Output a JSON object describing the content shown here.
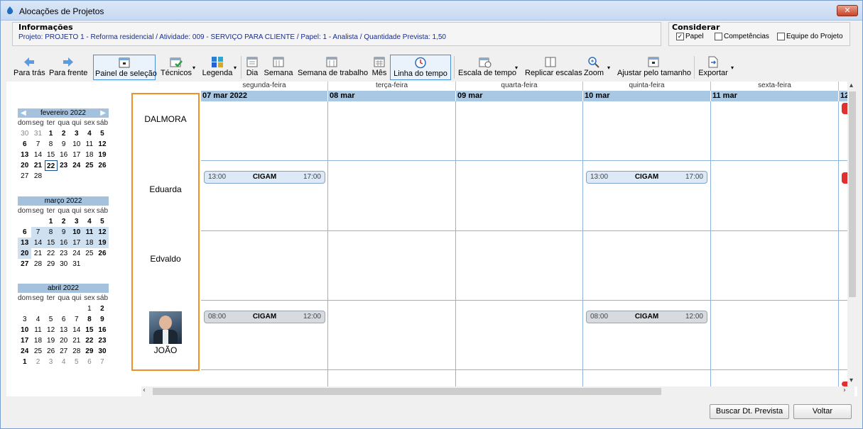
{
  "window": {
    "title": "Alocações de Projetos",
    "close_label": "✕"
  },
  "info": {
    "title": "Informações",
    "details": "Projeto: PROJETO 1 - Reforma residencial  /  Atividade: 009 - SERVIÇO PARA CLIENTE  /  Papel: 1 - Analista  /  Quantidade Prevista: 1,50"
  },
  "consider": {
    "title": "Considerar",
    "options": [
      {
        "label": "Papel",
        "checked": "✓"
      },
      {
        "label": "Competências",
        "checked": ""
      },
      {
        "label": "Equipe do Projeto",
        "checked": ""
      }
    ]
  },
  "toolbar": {
    "back": "Para trás",
    "forward": "Para frente",
    "selection_panel": "Painel de seleção",
    "technicians": "Técnicos",
    "legend": "Legenda",
    "day": "Dia",
    "week": "Semana",
    "work_week": "Semana de trabalho",
    "month": "Mês",
    "timeline": "Linha do tempo",
    "time_scale": "Escala de tempo",
    "replicate_scales": "Replicar escalas",
    "zoom": "Zoom",
    "fit_size": "Ajustar pelo tamanho",
    "export": "Exportar"
  },
  "mini_calendars": [
    {
      "title": "fevereiro 2022",
      "dow": [
        "dom",
        "seg",
        "ter",
        "qua",
        "qui",
        "sex",
        "sáb"
      ],
      "days": [
        "30",
        "31",
        "1",
        "2",
        "3",
        "4",
        "5",
        "6",
        "7",
        "8",
        "9",
        "10",
        "11",
        "12",
        "13",
        "14",
        "15",
        "16",
        "17",
        "18",
        "19",
        "20",
        "21",
        "22",
        "23",
        "24",
        "25",
        "26",
        "27",
        "28"
      ]
    },
    {
      "title": "março 2022",
      "dow": [
        "dom",
        "seg",
        "ter",
        "qua",
        "qui",
        "sex",
        "sáb"
      ],
      "days": [
        "",
        "",
        "1",
        "2",
        "3",
        "4",
        "5",
        "6",
        "7",
        "8",
        "9",
        "10",
        "11",
        "12",
        "13",
        "14",
        "15",
        "16",
        "17",
        "18",
        "19",
        "20",
        "21",
        "22",
        "23",
        "24",
        "25",
        "26",
        "27",
        "28",
        "29",
        "30",
        "31"
      ]
    },
    {
      "title": "abril 2022",
      "dow": [
        "dom",
        "seg",
        "ter",
        "qua",
        "qui",
        "sex",
        "sáb"
      ],
      "days": [
        "",
        "",
        "",
        "",
        "",
        "1",
        "2",
        "3",
        "4",
        "5",
        "6",
        "7",
        "8",
        "9",
        "10",
        "11",
        "12",
        "13",
        "14",
        "15",
        "16",
        "17",
        "18",
        "19",
        "20",
        "21",
        "22",
        "23",
        "24",
        "25",
        "26",
        "27",
        "28",
        "29",
        "30",
        "1",
        "2",
        "3",
        "4",
        "5",
        "6",
        "7"
      ]
    }
  ],
  "resources": [
    "DALMORA",
    "Eduarda",
    "Edvaldo",
    "JOÃO"
  ],
  "schedule": {
    "weekdays": [
      "segunda-feira",
      "terça-feira",
      "quarta-feira",
      "quinta-feira",
      "sexta-feira"
    ],
    "dates": [
      "07 mar 2022",
      "08 mar",
      "09 mar",
      "10 mar",
      "11 mar",
      "12"
    ],
    "appointments": [
      {
        "start": "13:00",
        "subject": "CIGAM",
        "end": "17:00"
      },
      {
        "start": "13:00",
        "subject": "CIGAM",
        "end": "17:00"
      },
      {
        "start": "08:00",
        "subject": "CIGAM",
        "end": "12:00"
      },
      {
        "start": "08:00",
        "subject": "CIGAM",
        "end": "12:00"
      }
    ]
  },
  "footer": {
    "search_button": "Buscar Dt. Prevista",
    "back_button": "Voltar"
  },
  "colors": {
    "accent": "#f0902a",
    "header": "#a8c8e4",
    "appointment": "#dde9f6"
  }
}
